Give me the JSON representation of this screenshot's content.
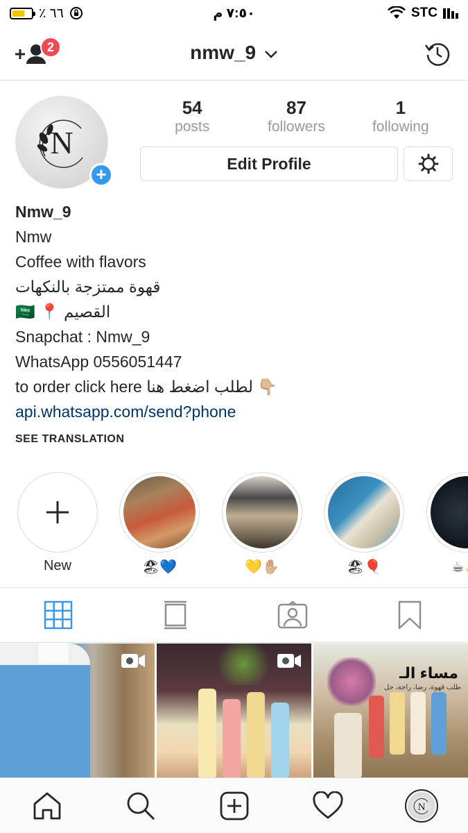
{
  "status_bar": {
    "battery_text": "٪ ٦٦",
    "time": "٧:٥٠ م",
    "carrier": "STC",
    "battery_level": 0.66
  },
  "nav": {
    "username": "nmw_9",
    "notification_count": "2",
    "icons": [
      "add-person-icon",
      "chevron-down-icon",
      "history-icon"
    ]
  },
  "profile": {
    "logo_letter": "N",
    "stats": [
      {
        "num": "54",
        "label": "posts"
      },
      {
        "num": "87",
        "label": "followers"
      },
      {
        "num": "1",
        "label": "following"
      }
    ],
    "edit_label": "Edit Profile"
  },
  "bio": {
    "name": "Nmw_9",
    "lines": [
      "Nmw",
      "Coffee with flavors",
      "قهوة ممتزجة بالنكهات",
      "القصيم 📍 🇸🇦",
      "Snapchat : Nmw_9",
      "WhatsApp 0556051447",
      "to order click here لطلب اضغط هنا 👇🏼"
    ],
    "link": "api.whatsapp.com/send?phone",
    "see_translation": "SEE TRANSLATION"
  },
  "highlights": [
    {
      "caption": "New"
    },
    {
      "caption": "🏖💙"
    },
    {
      "caption": "💛✋🏼"
    },
    {
      "caption": "🏖🎈"
    },
    {
      "caption": "☕✨"
    }
  ],
  "grid": {
    "tile3_caption": "مساء الـ",
    "tile3_sub": "طلب قهوة، رضا، راحة، حل"
  },
  "colors": {
    "accent_blue": "#3897f0",
    "badge_red": "#ed4956",
    "link_blue": "#003569"
  }
}
